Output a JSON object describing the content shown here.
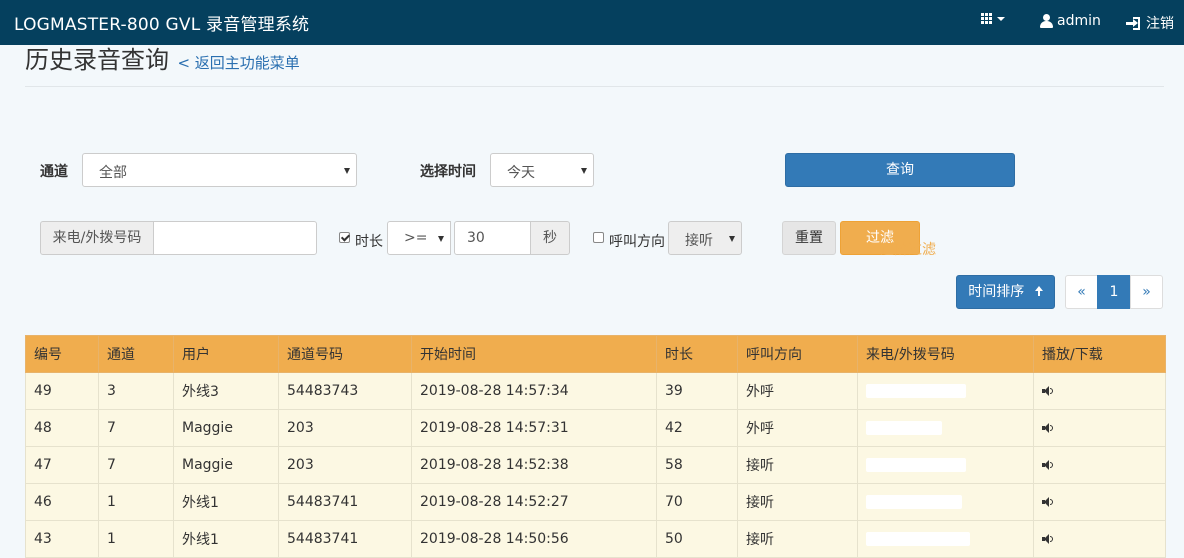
{
  "navbar": {
    "brand": "LOGMASTER-800 GVL 录音管理系统",
    "user_label": "admin",
    "logout_label": "注销"
  },
  "header": {
    "title": "历史录音查询",
    "back_link": "< 返回主功能菜单"
  },
  "search": {
    "channel_label": "通道",
    "channel_value": "全部",
    "time_label": "选择时间",
    "time_value": "今天",
    "query_button": "查询"
  },
  "filter": {
    "phone_addon": "来电/外拨号码",
    "phone_value": "",
    "duration_checked": true,
    "duration_label": "时长",
    "duration_operator": ">=",
    "duration_value": "30",
    "duration_unit": "秒",
    "direction_checked": false,
    "direction_label": "呼叫方向",
    "direction_value": "接听",
    "reset_button": "重置",
    "filter_button": "过滤",
    "advanced_link": "进阶过滤",
    "sort_button": "时间排序"
  },
  "pager": {
    "prev": "«",
    "current": "1",
    "next": "»"
  },
  "table": {
    "headers": [
      "编号",
      "通道",
      "用户",
      "通道号码",
      "开始时间",
      "时长",
      "呼叫方向",
      "来电/外拨号码",
      "播放/下载"
    ],
    "rows": [
      {
        "id": "49",
        "channel": "3",
        "user": "外线3",
        "number": "54483743",
        "start": "2019-08-28 14:57:34",
        "duration": "39",
        "direction": "外呼"
      },
      {
        "id": "48",
        "channel": "7",
        "user": "Maggie",
        "number": "203",
        "start": "2019-08-28 14:57:31",
        "duration": "42",
        "direction": "外呼"
      },
      {
        "id": "47",
        "channel": "7",
        "user": "Maggie",
        "number": "203",
        "start": "2019-08-28 14:52:38",
        "duration": "58",
        "direction": "接听"
      },
      {
        "id": "46",
        "channel": "1",
        "user": "外线1",
        "number": "54483741",
        "start": "2019-08-28 14:52:27",
        "duration": "70",
        "direction": "接听"
      },
      {
        "id": "43",
        "channel": "1",
        "user": "外线1",
        "number": "54483741",
        "start": "2019-08-28 14:50:56",
        "duration": "50",
        "direction": "接听"
      }
    ]
  },
  "icons": [
    "grid-icon",
    "user-icon",
    "logout-icon",
    "funnel-icon",
    "sort-up-icon",
    "speaker-icon"
  ],
  "colors": {
    "navbar": "#05405e",
    "primary": "#337ab7",
    "warning": "#f0ad4e",
    "row": "#fcf8e3"
  }
}
